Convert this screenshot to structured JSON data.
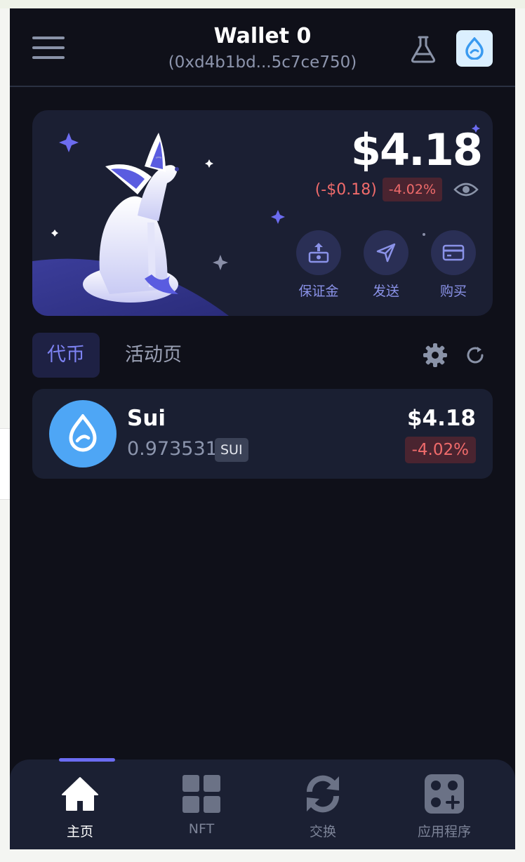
{
  "header": {
    "wallet_name": "Wallet 0",
    "wallet_address": "(0xd4b1bd...5c7ce750)",
    "menu_icon": "hamburger-menu-icon",
    "flask_icon": "flask-icon",
    "network_icon": "sui-drop-icon"
  },
  "balance_card": {
    "total_balance": "$4.18",
    "change_amount": "(-$0.18)",
    "change_percent": "-4.02%",
    "actions": [
      {
        "label": "保证金",
        "icon": "deposit-icon"
      },
      {
        "label": "发送",
        "icon": "send-icon"
      },
      {
        "label": "购买",
        "icon": "card-icon"
      }
    ]
  },
  "tabs": [
    {
      "label": "代币",
      "active": true
    },
    {
      "label": "活动页",
      "active": false
    }
  ],
  "tokens": [
    {
      "name": "Sui",
      "amount": "0.973531",
      "symbol": "SUI",
      "value": "$4.18",
      "change": "-4.02%"
    }
  ],
  "bottom_nav": [
    {
      "label": "主页",
      "icon": "home-icon",
      "active": true
    },
    {
      "label": "NFT",
      "icon": "grid-icon",
      "active": false
    },
    {
      "label": "交换",
      "icon": "swap-icon",
      "active": false
    },
    {
      "label": "应用程序",
      "icon": "apps-icon",
      "active": false
    }
  ],
  "colors": {
    "background": "#0f1019",
    "card": "#1b1f33",
    "accent": "#6b6cf2",
    "negative": "#f06b6b",
    "sui_blue": "#4ea6f5"
  }
}
